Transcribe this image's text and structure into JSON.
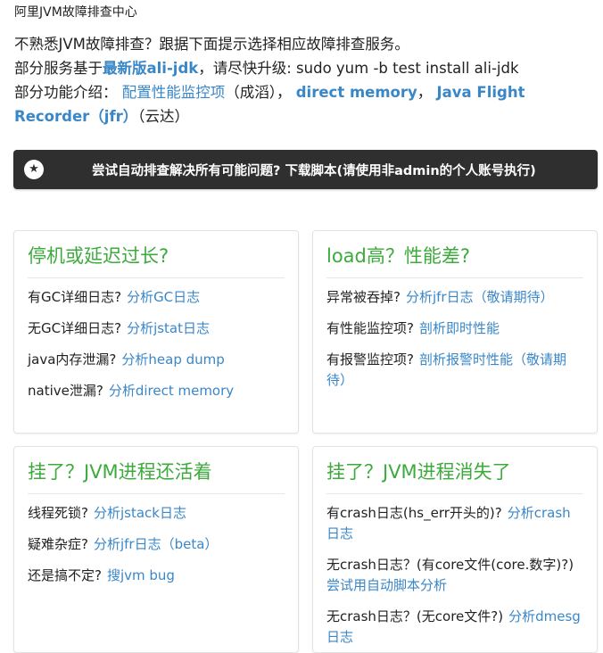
{
  "page_title": "阿里JVM故障排查中心",
  "intro": {
    "line1": "不熟悉JVM故障排查？跟据下面提示选择相应故障排查服务。",
    "line2_prefix": "部分服务基于",
    "line2_link": "最新版ali-jdk",
    "line2_suffix": "，请尽快升级: sudo yum -b test install ali-jdk",
    "line3_prefix": "部分功能介绍：",
    "link_perf": "配置性能监控项",
    "author_perf": "（成滔），",
    "link_direct": "direct memory",
    "sep": "，",
    "link_jfr_part1": "Java Flight",
    "link_jfr_part2": "Recorder（jfr）",
    "author_jfr": "（云达）"
  },
  "banner": {
    "icon": "star-icon",
    "text": "尝试自动排查解决所有可能问题? 下载脚本(请使用非admin的个人账号执行)"
  },
  "cards": [
    {
      "title": "停机或延迟过长?",
      "rows": [
        {
          "q": "有GC详细日志?",
          "link": "分析GC日志"
        },
        {
          "q": "无GC详细日志?",
          "link": "分析jstat日志"
        },
        {
          "q": "java内存泄漏?",
          "link": "分析heap dump"
        },
        {
          "q": "native泄漏?",
          "link": "分析direct memory"
        }
      ]
    },
    {
      "title": "load高？性能差?",
      "rows": [
        {
          "q": "异常被吞掉?",
          "link": "分析jfr日志（敬请期待）"
        },
        {
          "q": "有性能监控项?",
          "link": "剖析即时性能"
        },
        {
          "q": "有报警监控项?",
          "link": "剖析报警时性能（敬请期待）"
        }
      ]
    },
    {
      "title": "挂了？JVM进程还活着",
      "rows": [
        {
          "q": "线程死锁?",
          "link": "分析jstack日志"
        },
        {
          "q": "疑难杂症?",
          "link": "分析jfr日志（beta）"
        },
        {
          "q": "还是搞不定?",
          "link": "搜jvm bug"
        }
      ]
    },
    {
      "title": "挂了？JVM进程消失了",
      "rows": [
        {
          "q": "有crash日志(hs_err开头的)?",
          "link": "分析crash日志"
        },
        {
          "q": "无crash日志？(有core文件(core.数字)?)",
          "link": "尝试用自动脚本分析"
        },
        {
          "q": "无crash日志？(无core文件?)",
          "link": "分析dmesg日志"
        }
      ]
    }
  ],
  "colors": {
    "link": "#3a87c8",
    "card_title": "#3cab3c",
    "banner_bg": "#2f2f2f"
  }
}
